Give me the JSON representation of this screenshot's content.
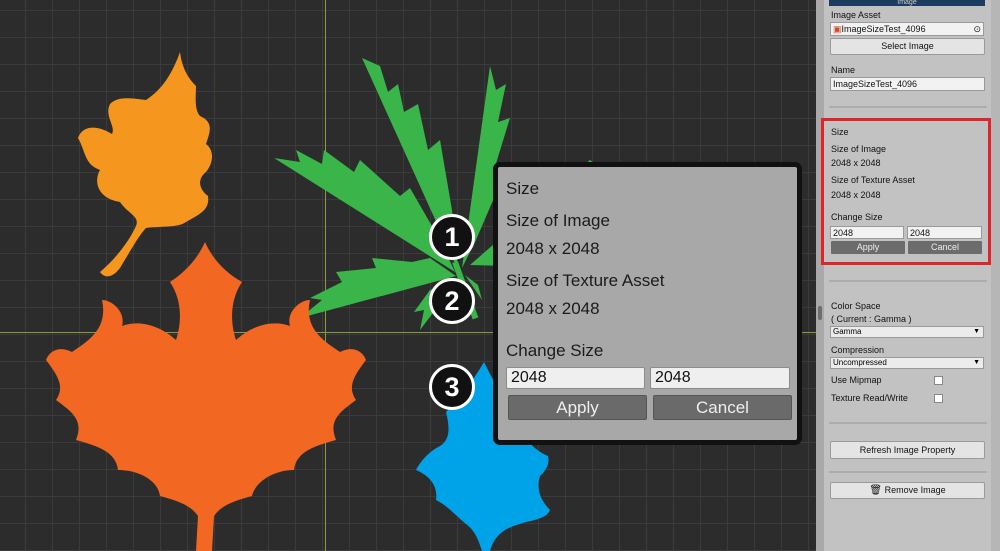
{
  "canvas": {
    "colors": {
      "orange_leaf": "#f5961e",
      "maple_leaf": "#f26722",
      "green_leaf": "#3ab54a",
      "blue_leaf": "#00a2e8"
    }
  },
  "callout": {
    "size_heading": "Size",
    "size_of_image_label": "Size of Image",
    "size_of_image_value": "2048 x 2048",
    "size_of_texture_label": "Size of Texture Asset",
    "size_of_texture_value": "2048 x 2048",
    "change_size_label": "Change Size",
    "width_value": "2048",
    "height_value": "2048",
    "apply_label": "Apply",
    "cancel_label": "Cancel"
  },
  "markers": [
    "1",
    "2",
    "3"
  ],
  "inspector": {
    "tab_title": "Image",
    "image_asset_label": "Image Asset",
    "image_asset_value": "ImageSizeTest_4096",
    "select_image_label": "Select Image",
    "name_label": "Name",
    "name_value": "ImageSizeTest_4096",
    "size_heading": "Size",
    "size_of_image_label": "Size of Image",
    "size_of_image_value": "2048 x 2048",
    "size_of_texture_label": "Size of Texture Asset",
    "size_of_texture_value": "2048 x 2048",
    "change_size_label": "Change Size",
    "width_value": "2048",
    "height_value": "2048",
    "apply_label": "Apply",
    "cancel_label": "Cancel",
    "color_space_label": "Color Space",
    "color_space_current": "( Current : Gamma )",
    "color_space_value": "Gamma",
    "compression_label": "Compression",
    "compression_value": "Uncompressed",
    "use_mipmap_label": "Use Mipmap",
    "use_mipmap_checked": false,
    "read_write_label": "Texture Read/Write",
    "read_write_checked": false,
    "refresh_label": "Refresh Image Property",
    "remove_label": "Remove Image",
    "highlight_color": "#e0242b"
  }
}
